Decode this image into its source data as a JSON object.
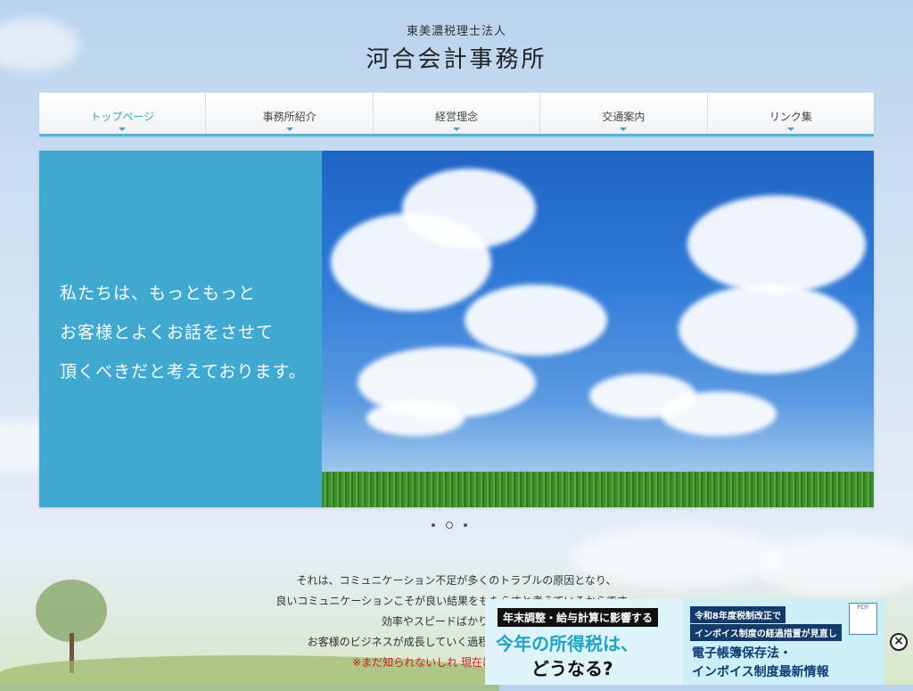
{
  "header": {
    "subtitle": "東美濃税理士法人",
    "title": "河合会計事務所"
  },
  "nav": {
    "items": [
      {
        "label": "トップページ",
        "active": true
      },
      {
        "label": "事務所紹介",
        "active": false
      },
      {
        "label": "経営理念",
        "active": false
      },
      {
        "label": "交通案内",
        "active": false
      },
      {
        "label": "リンク集",
        "active": false
      }
    ]
  },
  "hero": {
    "lines": [
      "私たちは、もっともっと",
      "お客様とよくお話をさせて",
      "頂くべきだと考えております。"
    ]
  },
  "slider": {
    "dots": 3,
    "active_index": 1
  },
  "intro": {
    "lines": [
      "それは、コミュニケーション不足が多くのトラブルの原因となり、",
      "良いコミュニケーションこそが良い結果をもたらすと考えているからです。",
      "効率やスピードばかりを追うつ",
      "お客様のビジネスが成長していく過程を着実にサポートして、",
      "※まだ知られないしれ 現在は新規開始中 年"
    ]
  },
  "banner": {
    "left_sub": "年末調整・給与計算に影響する",
    "left_main": "今年の所得税は、",
    "left_q": "どうなる?",
    "right_tag": "令和8年度税制改正で",
    "right_tag2": "インボイス制度の経過措置が見直し",
    "right_line1": "電子帳簿保存法・",
    "right_line2": "インボイス制度最新情報",
    "pdf_label": "PDF"
  },
  "close_label": "×",
  "colors": {
    "accent": "#3fa9d2",
    "nav_border": "#52b5dc",
    "nav_active": "#3aa2d0"
  }
}
